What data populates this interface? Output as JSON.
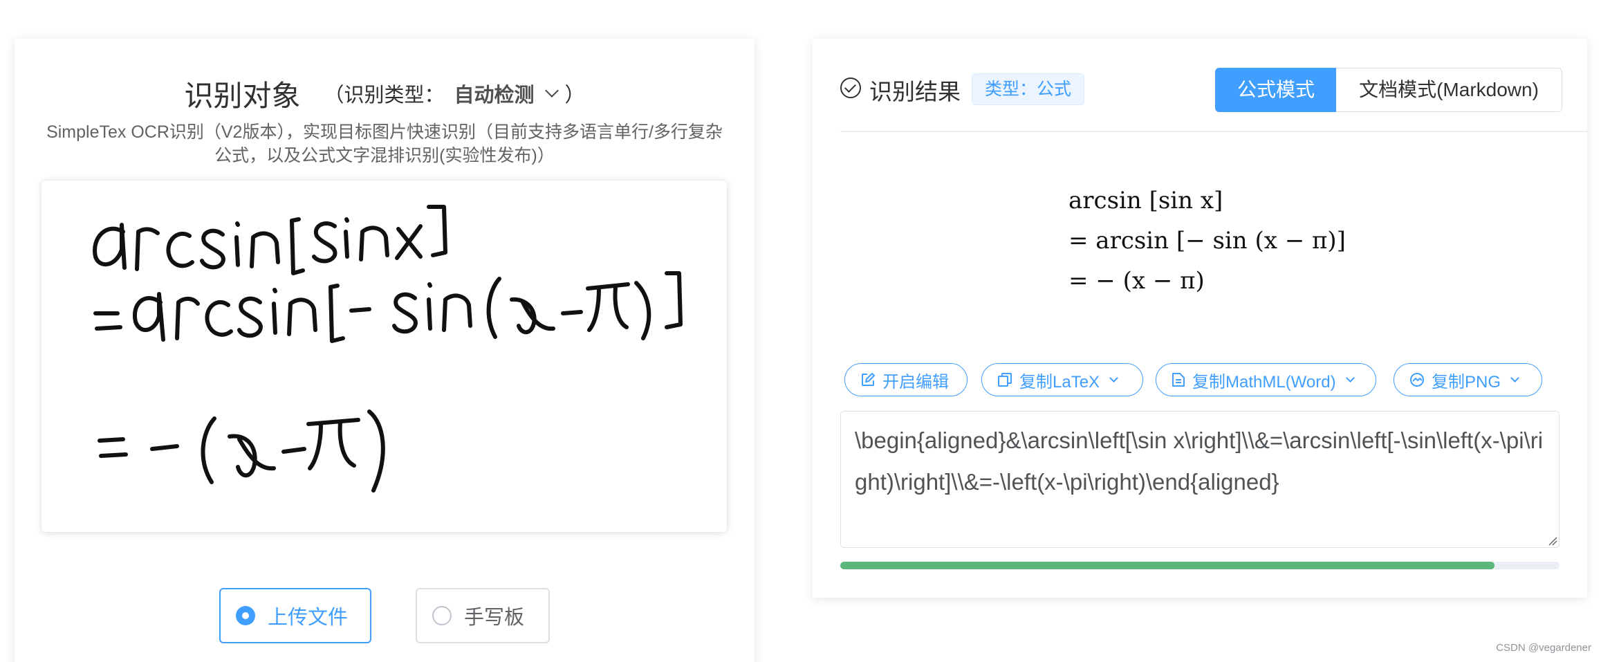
{
  "left": {
    "title": "识别对象",
    "type_open": "（",
    "type_label": "识别类型：",
    "type_value": "自动检测",
    "type_close": "）",
    "description": "SimpleTex OCR识别（V2版本），实现目标图片快速识别（目前支持多语言单行/多行复杂公式，以及公式文字混排识别(实验性发布)）",
    "mode_upload": "上传文件",
    "mode_handwrite": "手写板"
  },
  "right": {
    "title": "识别结果",
    "type_tag": "类型：公式",
    "mode_formula": "公式模式",
    "mode_document": "文档模式(Markdown)",
    "rendered_lines": [
      "arcsin [sin x]",
      "= arcsin [− sin (x − π)]",
      "= − (x − π)"
    ],
    "buttons": {
      "edit": "开启编辑",
      "copy_latex": "复制LaTeX",
      "copy_mathml": "复制MathML(Word)",
      "copy_png": "复制PNG"
    },
    "latex_output": "\\begin{aligned}&\\arcsin\\left[\\sin x\\right]\\\\&=\\arcsin\\left[-\\sin\\left(x-\\pi\\right)\\right]\\\\&=-\\left(x-\\pi\\right)\\end{aligned}",
    "progress_percent": 91
  },
  "watermark": "CSDN @vegardener",
  "colors": {
    "primary": "#409eff",
    "progress": "#5cb87a",
    "tag_bg": "#ecf5ff"
  }
}
